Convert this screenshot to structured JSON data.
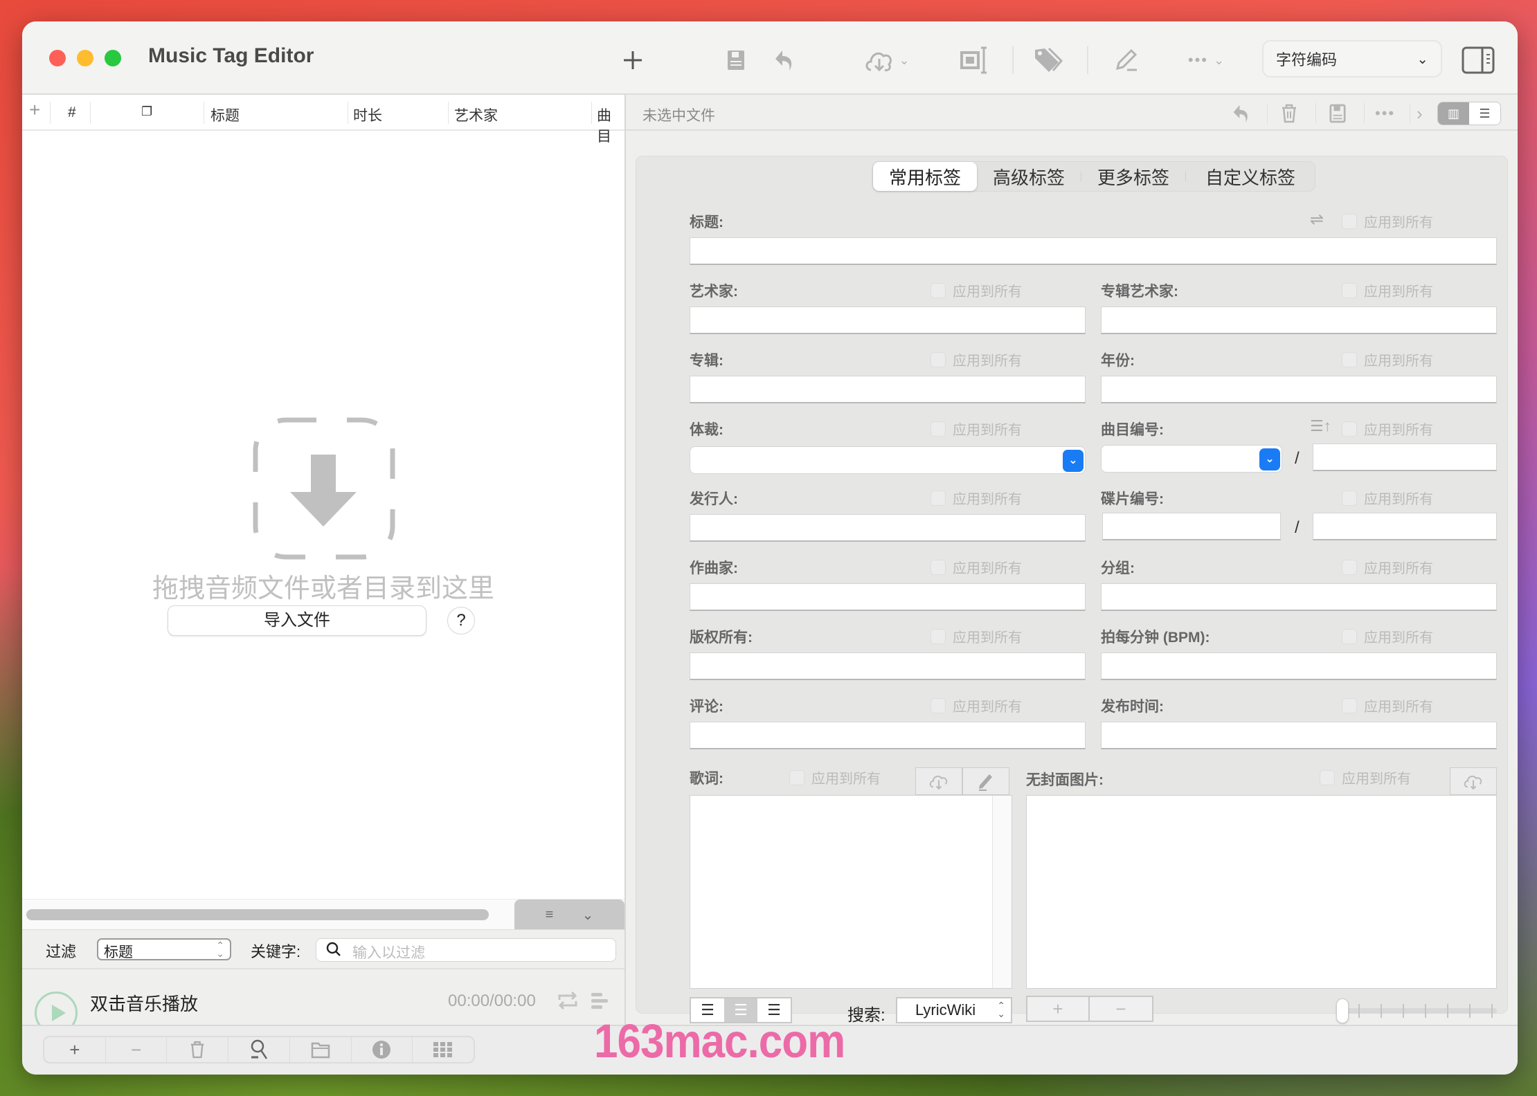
{
  "window": {
    "title": "Music Tag Editor",
    "encoding_select": "字符编码"
  },
  "toolbar": {
    "icons": [
      "add-icon",
      "save-icon",
      "undo-icon",
      "cloud-download-icon",
      "rename-icon",
      "tags-icon",
      "edit-icon",
      "more-icon",
      "sidebar-toggle-icon"
    ]
  },
  "file_list": {
    "columns": [
      "#",
      "标题",
      "时长",
      "艺术家",
      "曲目"
    ],
    "empty_message": "拖拽音频文件或者目录到这里",
    "import_button": "导入文件",
    "help_button": "?"
  },
  "filter": {
    "label": "过滤",
    "field_value": "标题",
    "keyword_label": "关键字:",
    "keyword_placeholder": "输入以过滤"
  },
  "player": {
    "title": "双击音乐播放",
    "time": "00:00/00:00",
    "progress": 0
  },
  "editor": {
    "header_title": "未选中文件",
    "tabs": [
      {
        "label": "常用标签",
        "active": true
      },
      {
        "label": "高级标签",
        "active": false
      },
      {
        "label": "更多标签",
        "active": false
      },
      {
        "label": "自定义标签",
        "active": false
      }
    ],
    "apply_all": "应用到所有",
    "fields": {
      "title": {
        "label": "标题:",
        "value": ""
      },
      "artist": {
        "label": "艺术家:",
        "value": ""
      },
      "album_artist": {
        "label": "专辑艺术家:",
        "value": ""
      },
      "album": {
        "label": "专辑:",
        "value": ""
      },
      "year": {
        "label": "年份:",
        "value": ""
      },
      "genre": {
        "label": "体裁:",
        "value": ""
      },
      "track": {
        "label": "曲目编号:",
        "value": "",
        "total": ""
      },
      "publisher": {
        "label": "发行人:",
        "value": ""
      },
      "disc": {
        "label": "碟片编号:",
        "value": "",
        "total": ""
      },
      "composer": {
        "label": "作曲家:",
        "value": ""
      },
      "grouping": {
        "label": "分组:",
        "value": ""
      },
      "copyright": {
        "label": "版权所有:",
        "value": ""
      },
      "bpm": {
        "label": "拍每分钟 (BPM):",
        "value": ""
      },
      "comment": {
        "label": "评论:",
        "value": ""
      },
      "release_time": {
        "label": "发布时间:",
        "value": ""
      },
      "lyrics": {
        "label": "歌词:",
        "value": ""
      },
      "cover": {
        "label": "无封面图片:"
      }
    },
    "separator": "/",
    "search_label": "搜索:",
    "search_source": "LyricWiki",
    "cover_add": "+",
    "cover_remove": "−"
  },
  "bottom_toolbar": {
    "buttons": [
      "+",
      "−",
      "trash",
      "search-file",
      "folder",
      "info",
      "grid"
    ]
  },
  "watermark": "163mac.com"
}
